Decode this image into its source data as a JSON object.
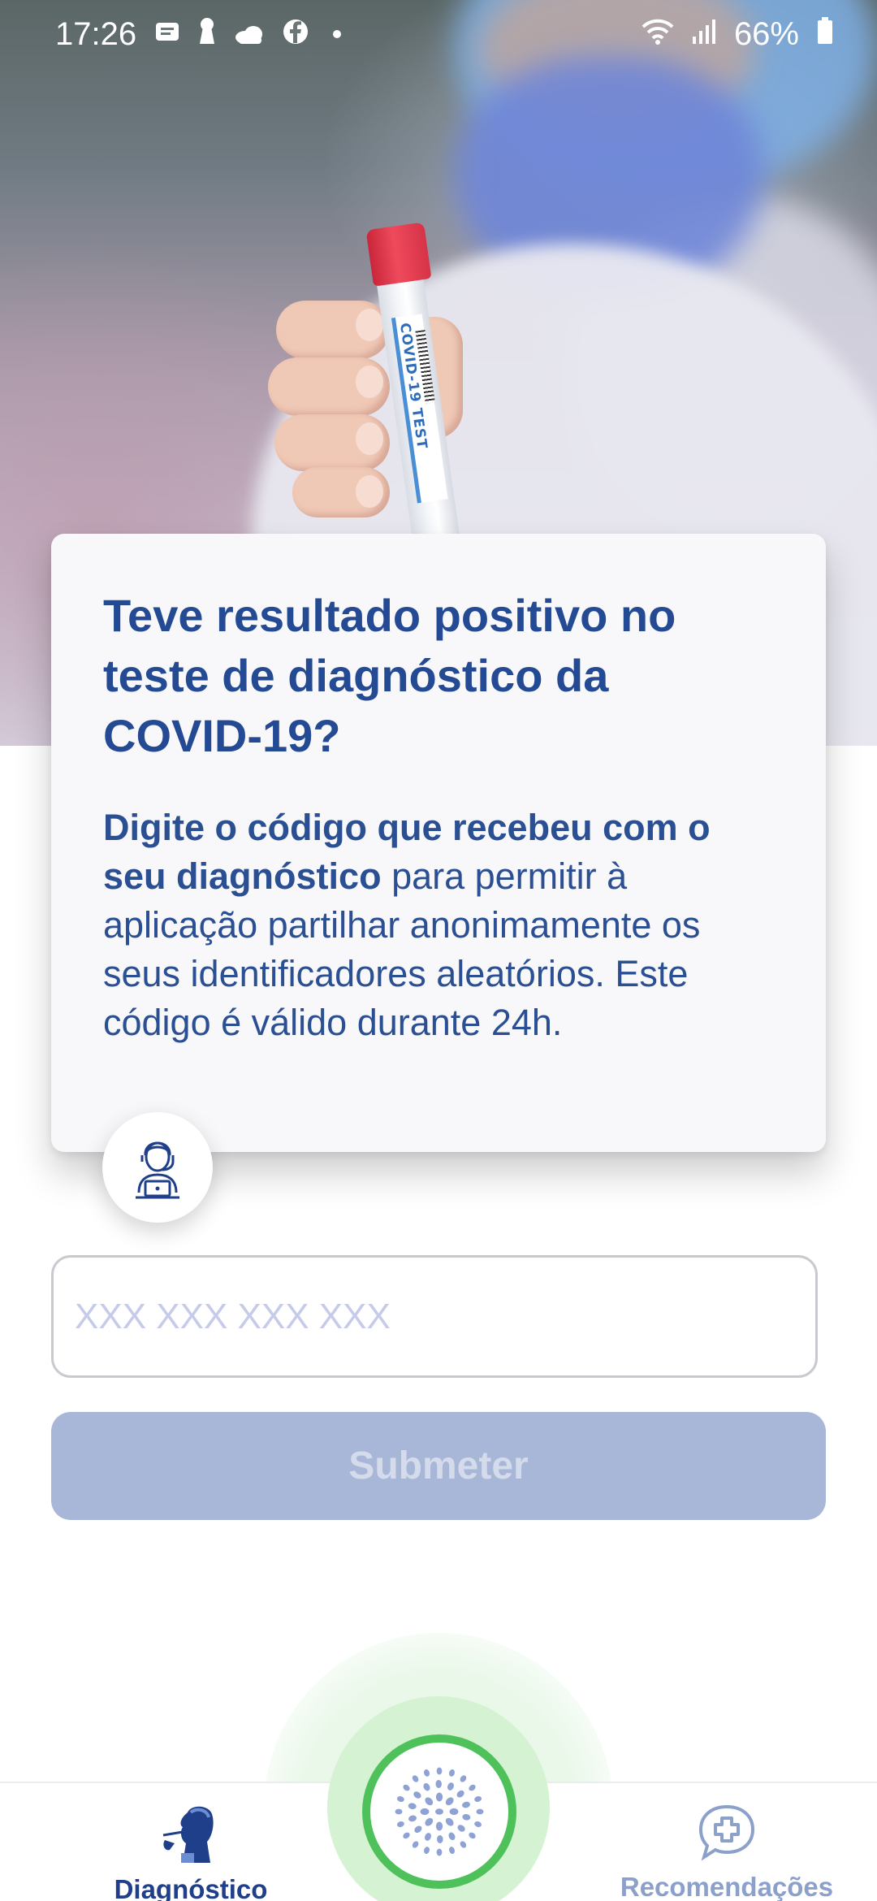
{
  "status_bar": {
    "time": "17:26",
    "battery": "66%",
    "icons": [
      "message-icon",
      "keyhole-icon",
      "cloud-icon",
      "facebook-icon",
      "dot-icon",
      "wifi-icon",
      "signal-icon",
      "battery-icon"
    ]
  },
  "hero": {
    "tube_label": "COVID-19 TEST"
  },
  "card": {
    "title": "Teve resultado positivo no teste de diagnóstico da COVID-19?",
    "description_bold": "Digite o código que recebeu com o seu diagnóstico",
    "description_rest": " para permitir à aplicação partilhar anonimamente os seus identificadores aleatórios. Este código é válido durante 24h."
  },
  "code_input": {
    "placeholder": "XXX XXX XXX XXX",
    "value": ""
  },
  "submit": {
    "label": "Submeter",
    "enabled": false
  },
  "bottom_nav": {
    "items": [
      {
        "label": "Diagnóstico",
        "icon": "person-test-icon",
        "active": true
      },
      {
        "label": "Recomendações",
        "icon": "chat-plus-icon",
        "active": false
      }
    ],
    "center_icon": "virus-dots-icon"
  },
  "colors": {
    "primary": "#244a93",
    "button_disabled": "#a8b7d8",
    "placeholder": "#c5cbe8",
    "fab_ring": "#4ec15a",
    "nav_inactive": "#8ca0cc"
  }
}
